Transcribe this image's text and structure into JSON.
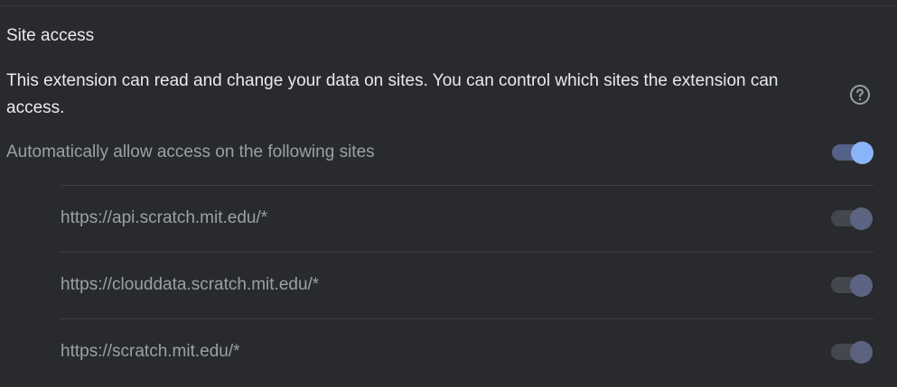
{
  "site_access": {
    "title": "Site access",
    "description": "This extension can read and change your data on sites. You can control which sites the extension can access.",
    "help_icon": "help-circle-icon",
    "auto_allow": {
      "label": "Automatically allow access on the following sites",
      "enabled": true
    },
    "sites": [
      {
        "url": "https://api.scratch.mit.edu/*",
        "enabled": true,
        "toggle_disabled": true
      },
      {
        "url": "https://clouddata.scratch.mit.edu/*",
        "enabled": true,
        "toggle_disabled": true
      },
      {
        "url": "https://scratch.mit.edu/*",
        "enabled": true,
        "toggle_disabled": true
      }
    ]
  },
  "colors": {
    "background": "#292a2d",
    "text_primary": "#e8eaed",
    "text_secondary": "#9aa0a6",
    "toggle_on_knob": "#8ab4f8",
    "toggle_on_track": "#556188",
    "toggle_disabled_knob": "#5b6380",
    "toggle_disabled_track": "#45474e",
    "divider": "#3f4044"
  }
}
